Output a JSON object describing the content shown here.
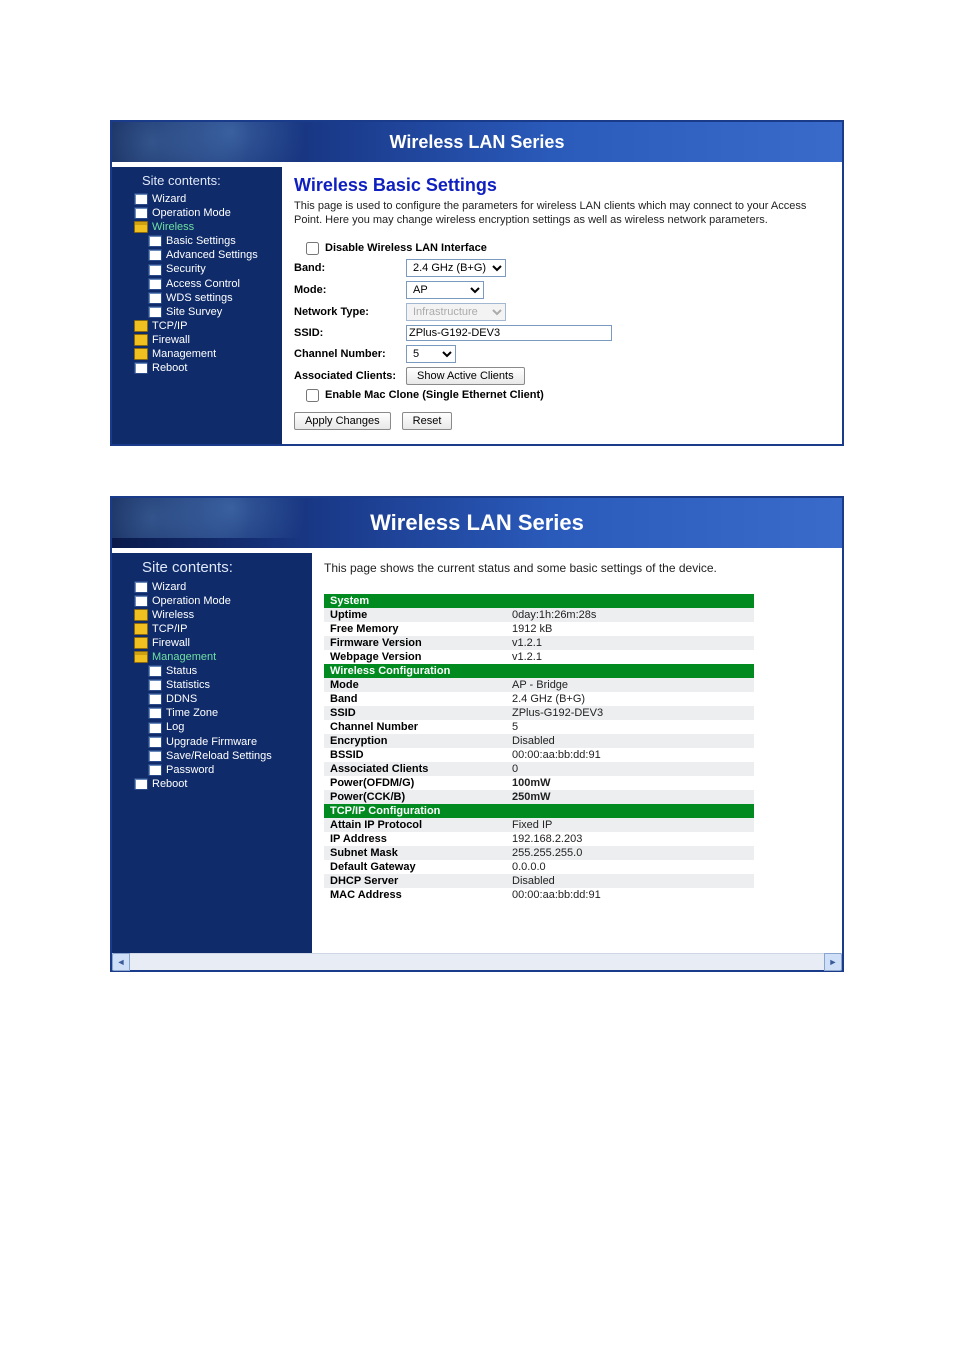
{
  "banner_title": "Wireless LAN Series",
  "shot1": {
    "sidebar_title": "Site contents:",
    "tree": [
      {
        "icon": "page",
        "label": "Wizard"
      },
      {
        "icon": "page",
        "label": "Operation Mode"
      },
      {
        "icon": "folder-open",
        "label": "Wireless",
        "active": true,
        "children": [
          {
            "icon": "page",
            "label": "Basic Settings"
          },
          {
            "icon": "page",
            "label": "Advanced Settings"
          },
          {
            "icon": "page",
            "label": "Security"
          },
          {
            "icon": "page",
            "label": "Access Control"
          },
          {
            "icon": "page",
            "label": "WDS settings"
          },
          {
            "icon": "page",
            "label": "Site Survey"
          }
        ]
      },
      {
        "icon": "folder",
        "label": "TCP/IP"
      },
      {
        "icon": "folder",
        "label": "Firewall"
      },
      {
        "icon": "folder",
        "label": "Management"
      },
      {
        "icon": "page",
        "label": "Reboot"
      }
    ],
    "page_title": "Wireless Basic Settings",
    "page_desc": "This page is used to configure the parameters for wireless LAN clients which may connect to your Access Point. Here you may change wireless encryption settings as well as wireless network parameters.",
    "disable_label": "Disable Wireless LAN Interface",
    "fields": {
      "band_label": "Band:",
      "band_value": "2.4 GHz (B+G)",
      "mode_label": "Mode:",
      "mode_value": "AP",
      "nettype_label": "Network Type:",
      "nettype_value": "Infrastructure",
      "ssid_label": "SSID:",
      "ssid_value": "ZPlus-G192-DEV3",
      "chan_label": "Channel Number:",
      "chan_value": "5",
      "assoc_label": "Associated Clients:",
      "assoc_button": "Show Active Clients",
      "macclone_label": "Enable Mac Clone (Single Ethernet Client)"
    },
    "apply_btn": "Apply Changes",
    "reset_btn": "Reset"
  },
  "shot2": {
    "sidebar_title": "Site contents:",
    "tree": [
      {
        "icon": "page",
        "label": "Wizard"
      },
      {
        "icon": "page",
        "label": "Operation Mode"
      },
      {
        "icon": "folder",
        "label": "Wireless"
      },
      {
        "icon": "folder",
        "label": "TCP/IP"
      },
      {
        "icon": "folder",
        "label": "Firewall"
      },
      {
        "icon": "folder-open",
        "label": "Management",
        "active": true,
        "children": [
          {
            "icon": "page",
            "label": "Status"
          },
          {
            "icon": "page",
            "label": "Statistics"
          },
          {
            "icon": "page",
            "label": "DDNS"
          },
          {
            "icon": "page",
            "label": "Time Zone"
          },
          {
            "icon": "page",
            "label": "Log"
          },
          {
            "icon": "page",
            "label": "Upgrade Firmware"
          },
          {
            "icon": "page",
            "label": "Save/Reload Settings"
          },
          {
            "icon": "page",
            "label": "Password"
          }
        ]
      },
      {
        "icon": "page",
        "label": "Reboot"
      }
    ],
    "page_desc": "This page shows the current status and some basic settings of the device.",
    "sections": [
      {
        "title": "System",
        "rows": [
          {
            "k": "Uptime",
            "v": "0day:1h:26m:28s"
          },
          {
            "k": "Free Memory",
            "v": "1912 kB"
          },
          {
            "k": "Firmware Version",
            "v": "v1.2.1"
          },
          {
            "k": "Webpage Version",
            "v": "v1.2.1"
          }
        ]
      },
      {
        "title": "Wireless Configuration",
        "rows": [
          {
            "k": "Mode",
            "v": "AP - Bridge"
          },
          {
            "k": "Band",
            "v": "2.4 GHz (B+G)"
          },
          {
            "k": "SSID",
            "v": "ZPlus-G192-DEV3"
          },
          {
            "k": "Channel Number",
            "v": "5"
          },
          {
            "k": "Encryption",
            "v": "Disabled"
          },
          {
            "k": "BSSID",
            "v": "00:00:aa:bb:dd:91"
          },
          {
            "k": "Associated Clients",
            "v": "0"
          },
          {
            "k": "Power(OFDM/G)",
            "v": "100mW",
            "bold": true
          },
          {
            "k": "Power(CCK/B)",
            "v": "250mW",
            "bold": true
          }
        ]
      },
      {
        "title": "TCP/IP Configuration",
        "rows": [
          {
            "k": "Attain IP Protocol",
            "v": "Fixed IP"
          },
          {
            "k": "IP Address",
            "v": "192.168.2.203"
          },
          {
            "k": "Subnet Mask",
            "v": "255.255.255.0"
          },
          {
            "k": "Default Gateway",
            "v": "0.0.0.0"
          },
          {
            "k": "DHCP Server",
            "v": "Disabled"
          },
          {
            "k": "MAC Address",
            "v": "00:00:aa:bb:dd:91"
          }
        ]
      }
    ]
  }
}
